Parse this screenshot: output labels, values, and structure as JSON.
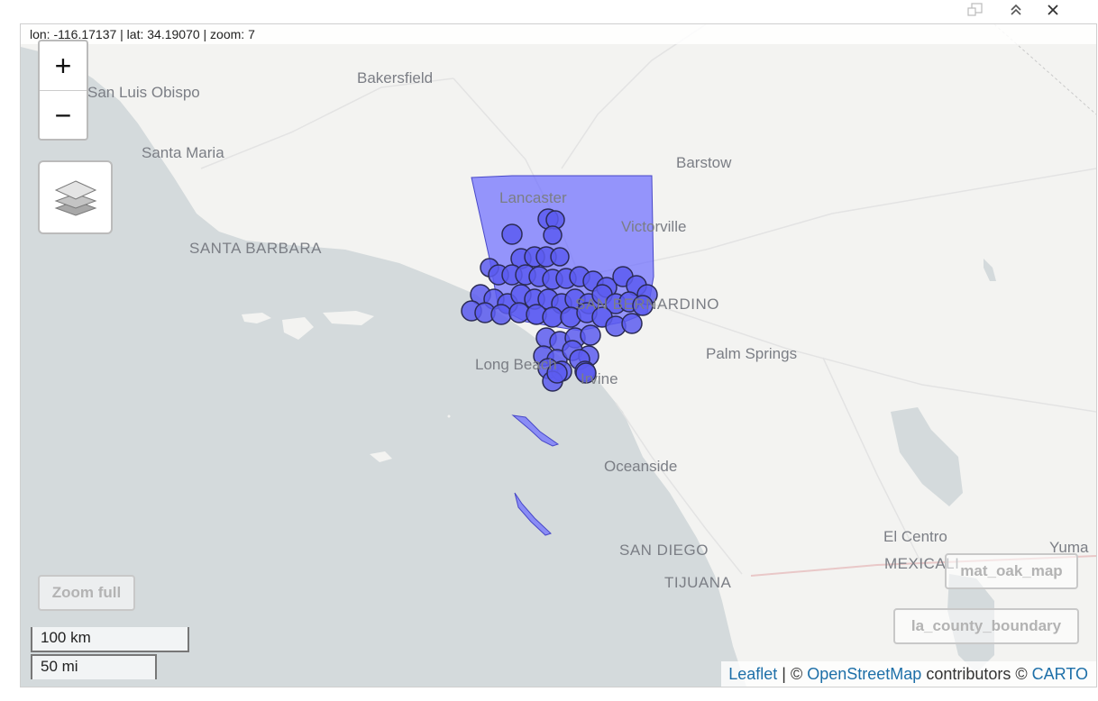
{
  "window": {
    "controls": [
      "popout-icon",
      "collapse-icon",
      "close-icon"
    ]
  },
  "map": {
    "coords_readout": "lon: -116.17137 | lat: 34.19070 | zoom: 7",
    "zoom_in_label": "+",
    "zoom_out_label": "−",
    "zoom_full_label": "Zoom full",
    "layer_buttons": [
      "mat_oak_map",
      "la_county_boundary"
    ],
    "scale_km": "100 km",
    "scale_mi": "50 mi",
    "places": {
      "san_luis_obispo": "San Luis Obispo",
      "bakersfield": "Bakersfield",
      "santa_maria": "Santa Maria",
      "barstow": "Barstow",
      "lancaster": "Lancaster",
      "victorville": "Victorville",
      "santa_barbara": "SANTA BARBARA",
      "san_bernardino": "SAN BERNARDINO",
      "palm_springs": "Palm Springs",
      "long_beach": "Long Beach",
      "irvine": "Irvine",
      "oceanside": "Oceanside",
      "san_diego": "SAN DIEGO",
      "tijuana": "TIJUANA",
      "el_centro": "El Centro",
      "mexicali": "MEXICALI",
      "yuma": "Yuma"
    },
    "attribution": {
      "leaflet": "Leaflet",
      "sep1": " | © ",
      "osm": "OpenStreetMap",
      "mid": " contributors © ",
      "carto": "CARTO"
    },
    "colors": {
      "water": "#d4dadc",
      "land": "#f3f3f1",
      "overlay_fill": "#6b6bff",
      "marker_fill": "#5c5cf0",
      "marker_stroke": "#2b2b55",
      "link": "#1d6fa8"
    }
  }
}
